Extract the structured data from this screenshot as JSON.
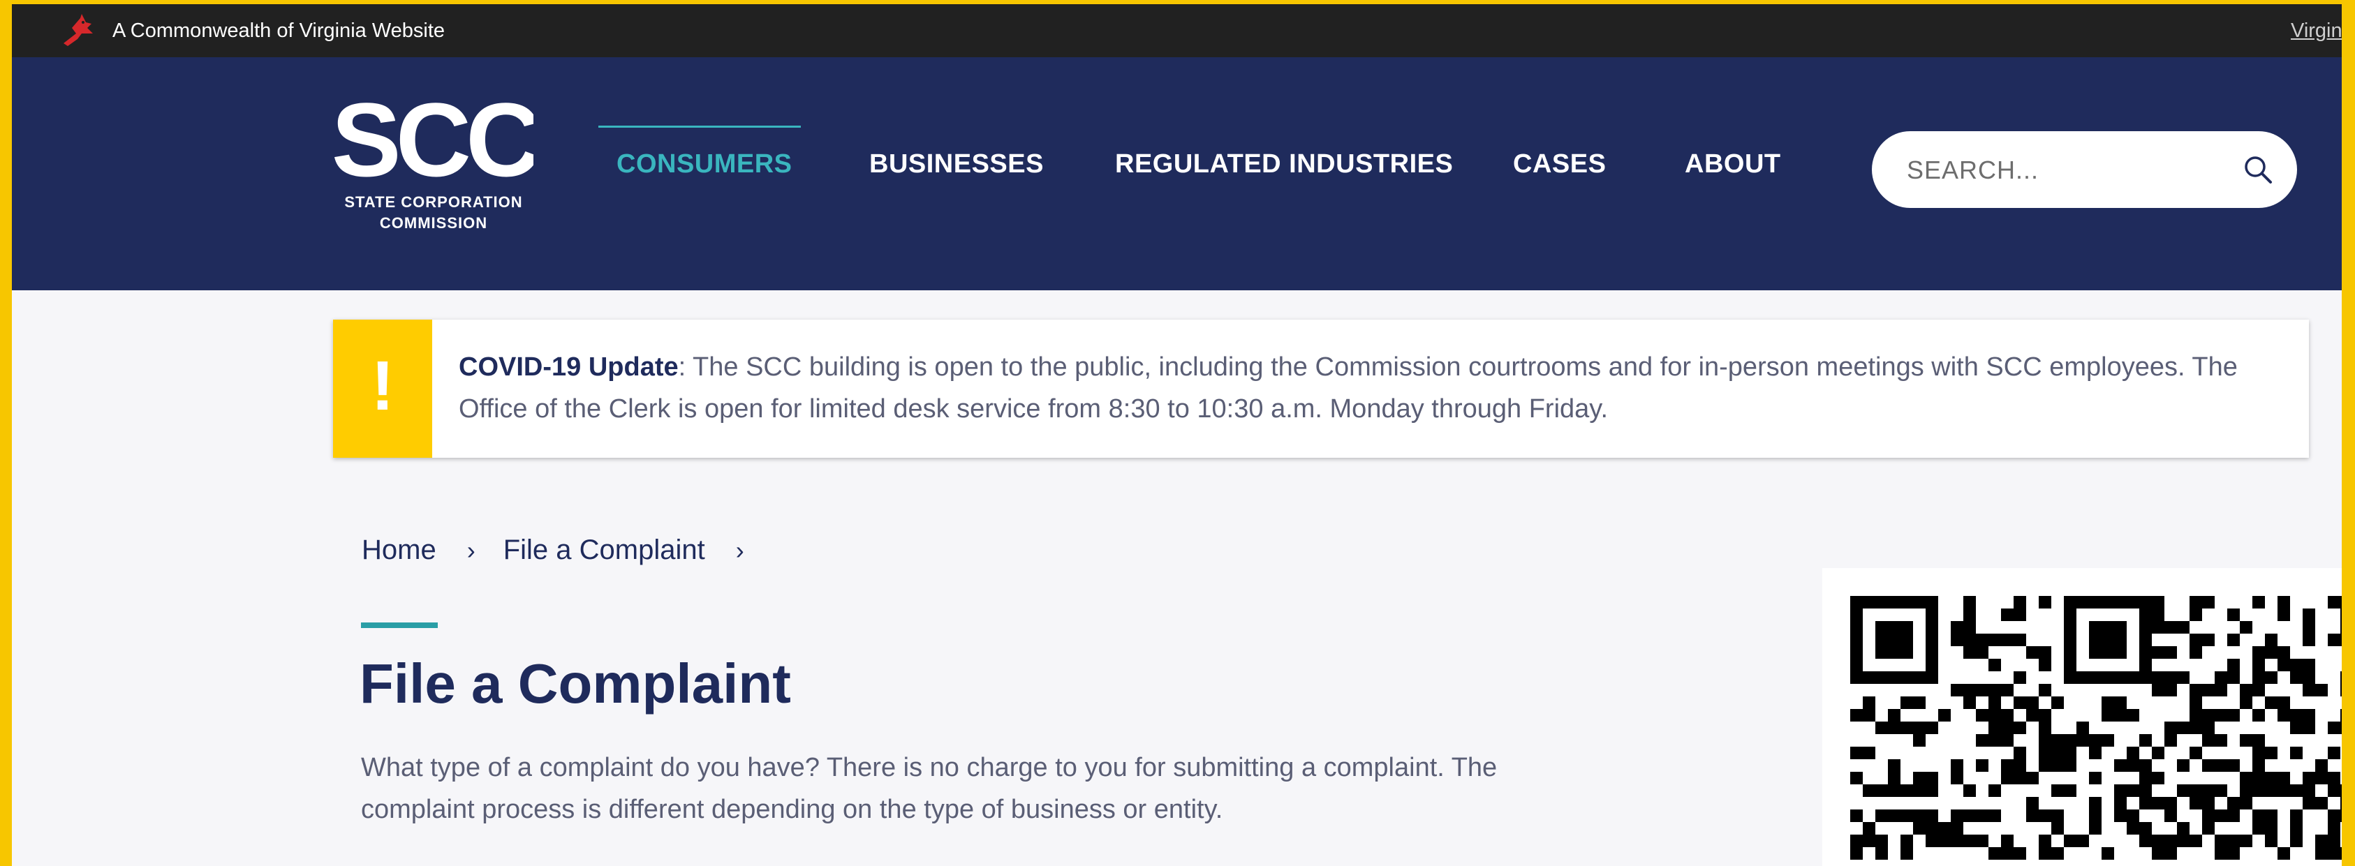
{
  "util_bar": {
    "commonwealth_text": "A Commonwealth of Virginia Website",
    "link_text": "Virgin"
  },
  "logo": {
    "letters": "SCC",
    "line1": "STATE CORPORATION",
    "line2": "COMMISSION"
  },
  "nav": {
    "items": [
      {
        "label": "CONSUMERS",
        "active": true
      },
      {
        "label": "BUSINESSES",
        "active": false
      },
      {
        "label": "REGULATED INDUSTRIES",
        "active": false
      },
      {
        "label": "CASES",
        "active": false
      },
      {
        "label": "ABOUT",
        "active": false
      }
    ]
  },
  "search": {
    "placeholder": "SEARCH...",
    "icon": "search-icon"
  },
  "banner": {
    "icon": "!",
    "heading": "COVID-19 Update",
    "body": ": The SCC building is open to the public, including the Commission courtrooms and for in-person meetings with SCC employees. The Office of the Clerk is open for limited desk service from 8:30 to 10:30 a.m. Monday through Friday."
  },
  "breadcrumb": {
    "items": [
      "Home",
      "File a Complaint"
    ],
    "separator": "›"
  },
  "main": {
    "title": "File a Complaint",
    "intro": "What type of a complaint do you have? There is no charge to you for submitting a complaint. The complaint process is different depending on the type of business or entity."
  },
  "colors": {
    "header_bg": "#1f2b5c",
    "accent_teal": "#3ab6bf",
    "alert_yellow": "#ffcc00",
    "util_bar_bg": "#212121",
    "frame_yellow": "#f7c600"
  }
}
